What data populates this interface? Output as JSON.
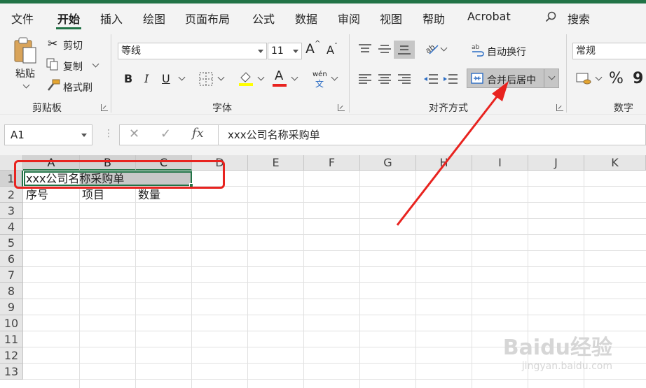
{
  "tabs": [
    "文件",
    "开始",
    "插入",
    "绘图",
    "页面布局",
    "公式",
    "数据",
    "审阅",
    "视图",
    "帮助",
    "Acrobat"
  ],
  "search_label": "搜索",
  "clipboard": {
    "paste": "粘贴",
    "cut": "剪切",
    "copy": "复制",
    "format_painter": "格式刷",
    "group": "剪贴板"
  },
  "font": {
    "name": "等线",
    "size": "11",
    "group": "字体",
    "phonetic": "wén",
    "phonetic_char": "文",
    "grow": "A",
    "shrink": "A",
    "bold": "B",
    "italic": "I",
    "underline": "U",
    "font_color": "A",
    "highlight": "A"
  },
  "alignment": {
    "wrap_text": "自动换行",
    "merge_center": "合并后居中",
    "group": "对齐方式"
  },
  "number": {
    "format": "常规",
    "percent": "%",
    "comma": "9",
    "group": "数字"
  },
  "formula_bar": {
    "name_box": "A1",
    "fx": "fx",
    "content": "xxx公司名称采购单"
  },
  "columns": [
    "A",
    "B",
    "C",
    "D",
    "E",
    "F",
    "G",
    "H",
    "I",
    "J",
    "K"
  ],
  "rows": [
    "1",
    "2",
    "3",
    "4",
    "5",
    "6",
    "7",
    "8",
    "9",
    "10",
    "11",
    "12",
    "13"
  ],
  "cells": {
    "a1": "xxx公司名称采购单",
    "a2": "序号",
    "b2": "项目",
    "c2": "数量"
  },
  "colors": {
    "accent": "#217346",
    "annotation": "#e8231f"
  },
  "watermark": {
    "main": "Baidu经验",
    "url": "jingyan.baidu.com"
  }
}
